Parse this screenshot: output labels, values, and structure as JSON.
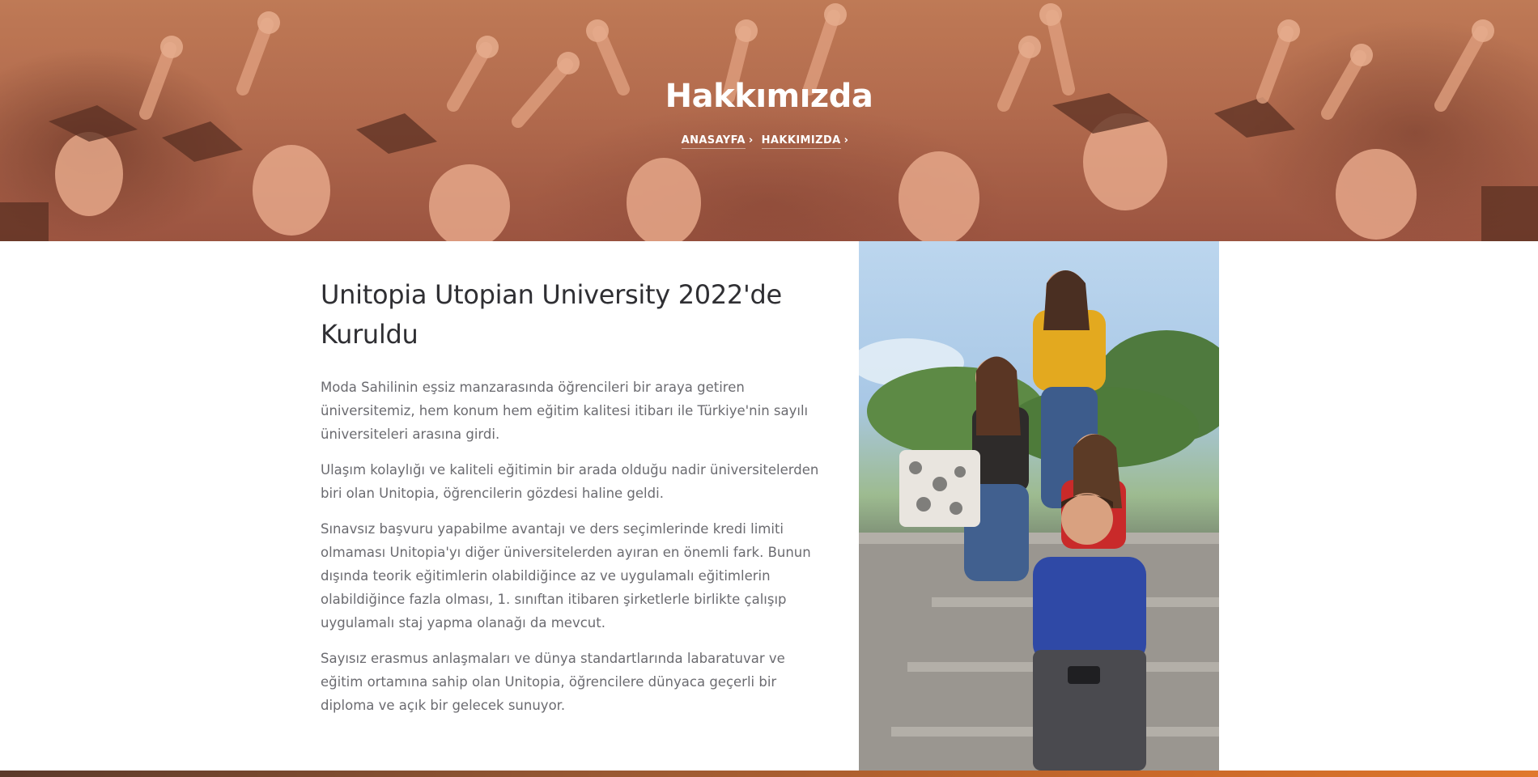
{
  "hero": {
    "title": "Hakkımızda",
    "breadcrumb": [
      {
        "label": "ANASAYFA",
        "separator": "›"
      },
      {
        "label": "HAKKIMIZDA",
        "separator": "›"
      }
    ]
  },
  "about": {
    "heading": "Unitopia Utopian University 2022'de Kuruldu",
    "paragraphs": [
      "Moda Sahilinin eşsiz manzarasında öğrencileri bir araya getiren üniversitemiz, hem konum hem eğitim kalitesi itibarı ile Türkiye'nin sayılı üniversiteleri arasına girdi.",
      "Ulaşım kolaylığı ve kaliteli eğitimin bir arada olduğu nadir üniversitelerden biri olan Unitopia, öğrencilerin gözdesi haline geldi.",
      "Sınavsız başvuru yapabilme avantajı ve ders seçimlerinde kredi limiti olmaması Unitopia'yı diğer üniversitelerden ayıran en önemli fark. Bunun dışında teorik eğitimlerin olabildiğince az ve uygulamalı eğitimlerin olabildiğince fazla olması, 1. sınıftan itibaren şirketlerle birlikte çalışıp uygulamalı staj yapma olanağı da mevcut.",
      "Sayısız erasmus anlaşmaları ve dünya standartlarında labaratuvar ve eğitim ortamına sahip olan Unitopia, öğrencilere dünyaca geçerli bir diploma ve açık bir gelecek sunuyor."
    ]
  },
  "colors": {
    "hero_tint": "#b77a58",
    "heading_text": "#2f2f33",
    "body_text": "#6b6b70",
    "accent_band": "#e0782c"
  }
}
